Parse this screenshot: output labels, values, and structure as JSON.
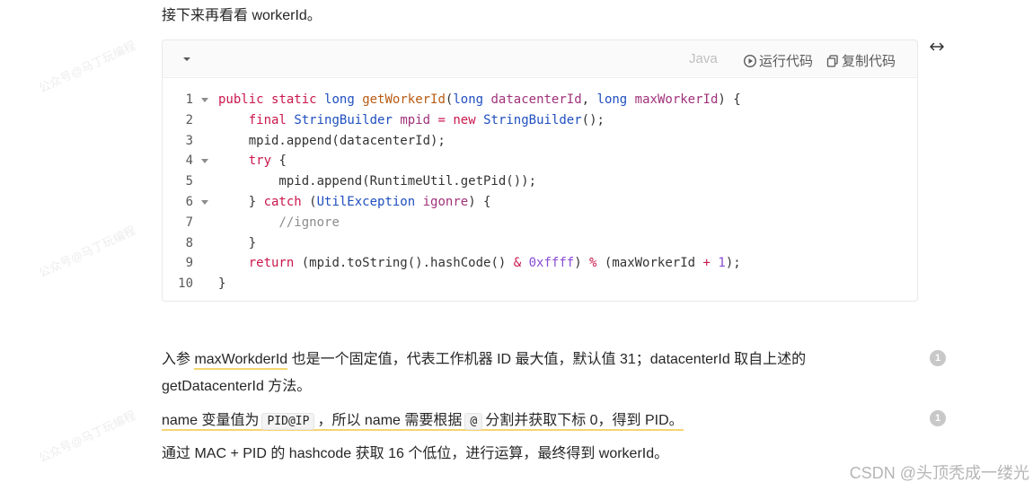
{
  "intro_text": "接下来再看看 workerId。",
  "code_block": {
    "language": "Java",
    "run_label": "运行代码",
    "copy_label": "复制代码",
    "line_numbers": [
      "1",
      "2",
      "3",
      "4",
      "5",
      "6",
      "7",
      "8",
      "9",
      "10"
    ],
    "fold_lines": [
      1,
      4,
      6
    ]
  },
  "paragraph1": {
    "prefix": "入参 ",
    "highlight": "maxWorkderId",
    "suffix": " 也是一个固定值，代表工作机器 ID 最大值，默认值 31；datacenterId 取自上述的 getDatacenterId 方法。"
  },
  "paragraph2": {
    "part1": "name 变量值为",
    "code1": "PID@IP",
    "part2": "，所以 name 需要根据",
    "code2": "@",
    "part3": "分割并获取下标 0，得到 PID。"
  },
  "paragraph3": "通过 MAC + PID 的 hashcode 获取 16 个低位，进行运算，最终得到 workerId。",
  "comment_badges": [
    "1",
    "1"
  ],
  "watermark_text": "公众号@马丁玩编程",
  "credit": "CSDN @头顶秃成一缕光",
  "colors": {
    "underline": "#f5d572",
    "keyword": "#c9174c",
    "type": "#1f4fbf"
  }
}
